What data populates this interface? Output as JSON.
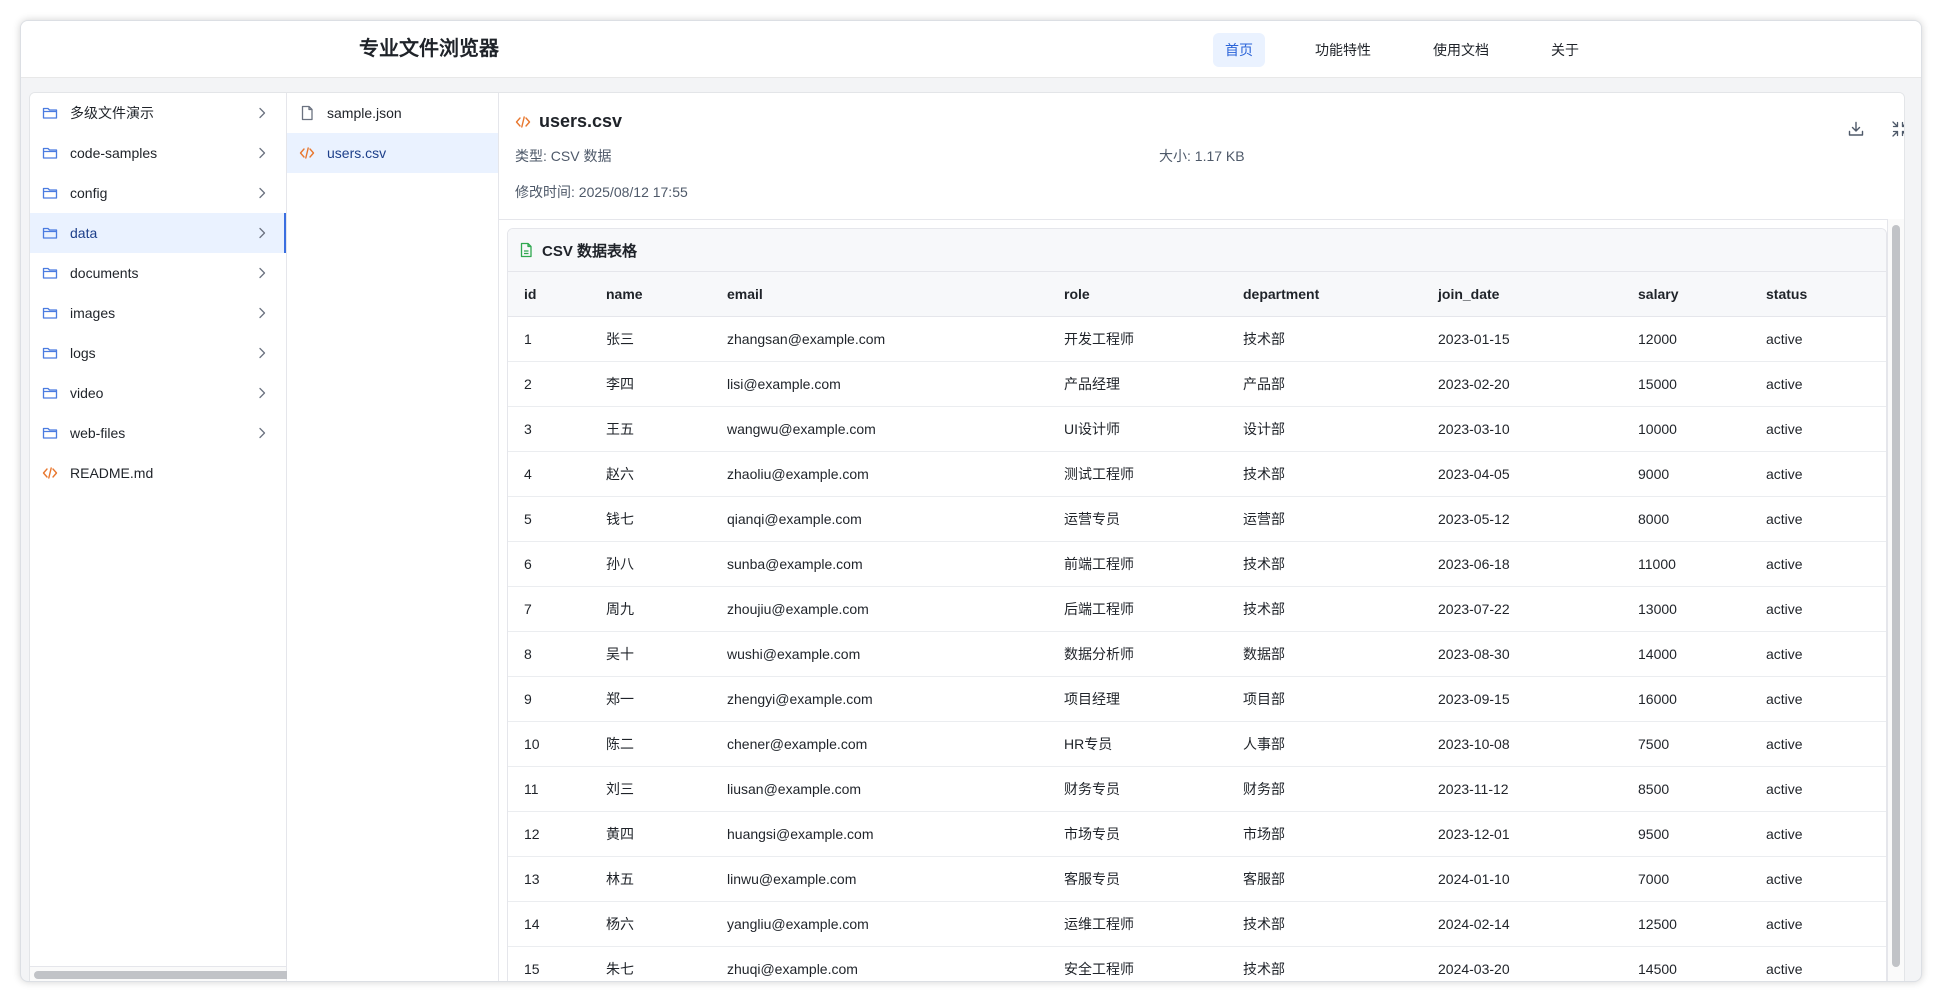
{
  "app": {
    "title": "专业文件浏览器"
  },
  "nav": [
    {
      "label": "首页",
      "active": true
    },
    {
      "label": "功能特性",
      "active": false
    },
    {
      "label": "使用文档",
      "active": false
    },
    {
      "label": "关于",
      "active": false
    }
  ],
  "tree": [
    {
      "label": "多级文件演示",
      "type": "folder"
    },
    {
      "label": "code-samples",
      "type": "folder"
    },
    {
      "label": "config",
      "type": "folder"
    },
    {
      "label": "data",
      "type": "folder",
      "selected": true
    },
    {
      "label": "documents",
      "type": "folder"
    },
    {
      "label": "images",
      "type": "folder"
    },
    {
      "label": "logs",
      "type": "folder"
    },
    {
      "label": "video",
      "type": "folder"
    },
    {
      "label": "web-files",
      "type": "folder"
    },
    {
      "label": "README.md",
      "type": "code-file"
    }
  ],
  "files": [
    {
      "label": "sample.json",
      "type": "file"
    },
    {
      "label": "users.csv",
      "type": "code-file",
      "selected": true
    }
  ],
  "detail": {
    "file_name": "users.csv",
    "type_label": "类型:",
    "type_value": "CSV 数据",
    "size_label": "大小:",
    "size_value": "1.17 KB",
    "modified_label": "修改时间:",
    "modified_value": "2025/08/12 17:55"
  },
  "table": {
    "title": "CSV 数据表格",
    "columns": [
      "id",
      "name",
      "email",
      "role",
      "department",
      "join_date",
      "salary",
      "status"
    ],
    "rows": [
      [
        "1",
        "张三",
        "zhangsan@example.com",
        "开发工程师",
        "技术部",
        "2023-01-15",
        "12000",
        "active"
      ],
      [
        "2",
        "李四",
        "lisi@example.com",
        "产品经理",
        "产品部",
        "2023-02-20",
        "15000",
        "active"
      ],
      [
        "3",
        "王五",
        "wangwu@example.com",
        "UI设计师",
        "设计部",
        "2023-03-10",
        "10000",
        "active"
      ],
      [
        "4",
        "赵六",
        "zhaoliu@example.com",
        "测试工程师",
        "技术部",
        "2023-04-05",
        "9000",
        "active"
      ],
      [
        "5",
        "钱七",
        "qianqi@example.com",
        "运营专员",
        "运营部",
        "2023-05-12",
        "8000",
        "active"
      ],
      [
        "6",
        "孙八",
        "sunba@example.com",
        "前端工程师",
        "技术部",
        "2023-06-18",
        "11000",
        "active"
      ],
      [
        "7",
        "周九",
        "zhoujiu@example.com",
        "后端工程师",
        "技术部",
        "2023-07-22",
        "13000",
        "active"
      ],
      [
        "8",
        "吴十",
        "wushi@example.com",
        "数据分析师",
        "数据部",
        "2023-08-30",
        "14000",
        "active"
      ],
      [
        "9",
        "郑一",
        "zhengyi@example.com",
        "项目经理",
        "项目部",
        "2023-09-15",
        "16000",
        "active"
      ],
      [
        "10",
        "陈二",
        "chener@example.com",
        "HR专员",
        "人事部",
        "2023-10-08",
        "7500",
        "active"
      ],
      [
        "11",
        "刘三",
        "liusan@example.com",
        "财务专员",
        "财务部",
        "2023-11-12",
        "8500",
        "active"
      ],
      [
        "12",
        "黄四",
        "huangsi@example.com",
        "市场专员",
        "市场部",
        "2023-12-01",
        "9500",
        "active"
      ],
      [
        "13",
        "林五",
        "linwu@example.com",
        "客服专员",
        "客服部",
        "2024-01-10",
        "7000",
        "active"
      ],
      [
        "14",
        "杨六",
        "yangliu@example.com",
        "运维工程师",
        "技术部",
        "2024-02-14",
        "12500",
        "active"
      ],
      [
        "15",
        "朱七",
        "zhuqi@example.com",
        "安全工程师",
        "技术部",
        "2024-03-20",
        "14500",
        "active"
      ]
    ]
  },
  "colors": {
    "accent": "#2b64d8",
    "selected_bg": "#eaf2ff",
    "folder_icon": "#4a7be0",
    "code_icon": "#e8772e",
    "csv_icon": "#2fa84f"
  },
  "icons": {
    "folder": "folder-icon",
    "file": "file-icon",
    "code_file": "code-file-icon",
    "chevron": "chevron-right-icon",
    "download": "download-icon",
    "collapse": "collapse-icon",
    "csv": "csv-file-icon"
  }
}
